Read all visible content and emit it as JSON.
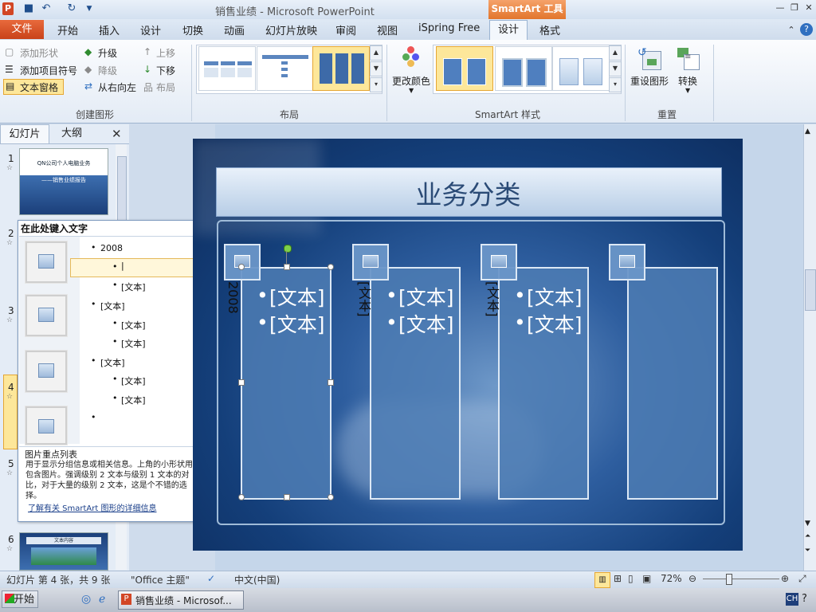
{
  "window": {
    "title": "销售业绩 - Microsoft PowerPoint",
    "contextual_tab": "SmartArt 工具"
  },
  "tabs": [
    {
      "label": "文件"
    },
    {
      "label": "开始"
    },
    {
      "label": "插入"
    },
    {
      "label": "设计"
    },
    {
      "label": "切换"
    },
    {
      "label": "动画"
    },
    {
      "label": "幻灯片放映"
    },
    {
      "label": "审阅"
    },
    {
      "label": "视图"
    },
    {
      "label": "iSpring Free"
    },
    {
      "label": "设计"
    },
    {
      "label": "格式"
    }
  ],
  "ribbon": {
    "create_graphic": {
      "add_shape": "添加形状",
      "add_bullet": "添加项目符号",
      "text_pane": "文本窗格",
      "promote": "升级",
      "demote": "降级",
      "right_to_left": "从右向左",
      "move_up": "上移",
      "move_down": "下移",
      "layout": "布局",
      "group_label": "创建图形"
    },
    "layouts": {
      "group_label": "布局"
    },
    "styles": {
      "change_colors": "更改颜色",
      "group_label": "SmartArt 样式"
    },
    "reset": {
      "reset_graphic": "重设图形",
      "convert": "转换",
      "group_label": "重置"
    }
  },
  "left_pane": {
    "tabs": [
      {
        "label": "幻灯片"
      },
      {
        "label": "大纲"
      }
    ],
    "slide_numbers": [
      "1",
      "2",
      "3",
      "4",
      "5",
      "6"
    ],
    "thumb1": {
      "title": "QN公司个人电脑业务",
      "subtitle": "——销售业绩报告"
    },
    "thumb6": {
      "title": "文本内容"
    }
  },
  "text_pane": {
    "title": "在此处键入文字",
    "items": [
      {
        "text": "2008",
        "level": 1
      },
      {
        "text": "|",
        "level": 2
      },
      {
        "text": "[文本]",
        "level": 2
      },
      {
        "text": "[文本]",
        "level": 1
      },
      {
        "text": "[文本]",
        "level": 2
      },
      {
        "text": "[文本]",
        "level": 2
      },
      {
        "text": "[文本]",
        "level": 1
      },
      {
        "text": "[文本]",
        "level": 2
      },
      {
        "text": "[文本]",
        "level": 2
      },
      {
        "text": "",
        "level": 1
      }
    ],
    "desc_title": "图片重点列表",
    "desc_body": "用于显示分组信息或相关信息。上角的小形状用于包含图片。强调级别 2 文本与级别 1 文本的对比，对于大量的级别 2 文本，这是个不错的选择。",
    "link": "了解有关 SmartArt 图形的详细信息"
  },
  "slide": {
    "title": "业务分类",
    "columns": [
      {
        "label": "2008",
        "bullets": [
          "[文本]",
          "[文本]"
        ]
      },
      {
        "label": "[文本]",
        "bullets": [
          "[文本]",
          "[文本]"
        ]
      },
      {
        "label": "[文本]",
        "bullets": [
          "[文本]",
          "[文本]"
        ]
      },
      {
        "label": "",
        "bullets": []
      }
    ]
  },
  "status": {
    "slide_info": "幻灯片 第 4 张，共 9 张",
    "theme": "\"Office 主题\"",
    "language": "中文(中国)",
    "zoom": "72%"
  },
  "taskbar": {
    "start": "开始",
    "task": "销售业绩 - Microsof...",
    "ime": "CH"
  },
  "colors": {
    "accent_orange": "#e2752c",
    "slide_blue": "#143f7a",
    "ribbon_bg": "#e3ebf5"
  }
}
